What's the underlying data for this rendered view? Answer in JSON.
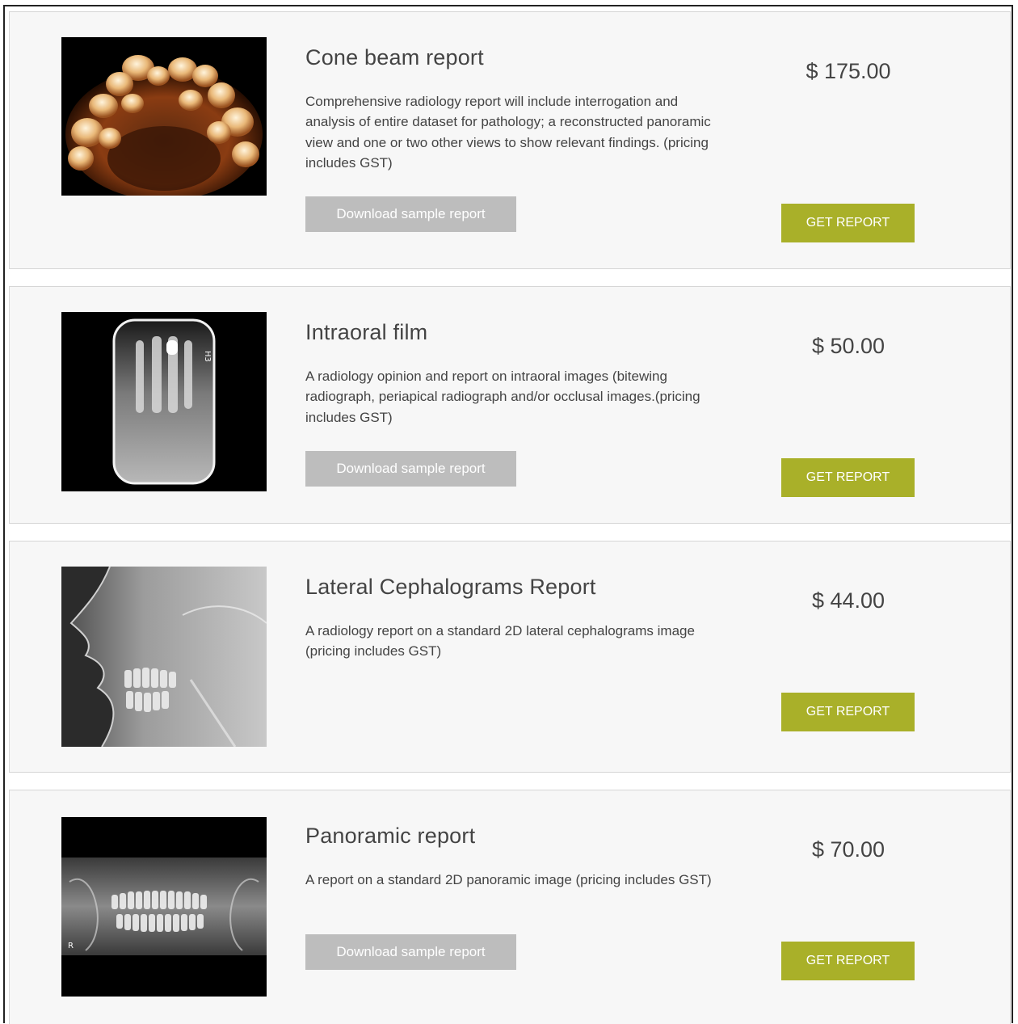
{
  "colors": {
    "card_background": "#f7f7f7",
    "card_border": "#d6d6d6",
    "sample_button": "#bdbdbd",
    "get_report_button": "#a9b029",
    "text": "#444444"
  },
  "products": [
    {
      "title": "Cone beam report",
      "description": "Comprehensive radiology report will include interrogation and analysis of entire dataset for pathology; a reconstructed panoramic view and one or two other views to show relevant findings. (pricing includes GST)",
      "sample_label": "Download sample report",
      "price": "$ 175.00",
      "cta_label": "GET REPORT",
      "image_icon": "cone-beam-3d-teeth-image"
    },
    {
      "title": "Intraoral film",
      "description": "A radiology opinion and report on intraoral images (bitewing radiograph, periapical radiograph and/or occlusal images.(pricing includes GST)",
      "sample_label": "Download sample report",
      "price": "$ 50.00",
      "cta_label": "GET REPORT",
      "image_icon": "intraoral-xray-image"
    },
    {
      "title": "Lateral Cephalograms Report",
      "description": "A radiology report on a standard 2D lateral cephalograms image (pricing includes GST)",
      "price": "$ 44.00",
      "cta_label": "GET REPORT",
      "image_icon": "lateral-cephalogram-image"
    },
    {
      "title": "Panoramic report",
      "description": "A report on a standard 2D panoramic image (pricing includes GST)",
      "sample_label": "Download sample report",
      "price": "$ 70.00",
      "cta_label": "GET REPORT",
      "image_icon": "panoramic-xray-image"
    }
  ]
}
